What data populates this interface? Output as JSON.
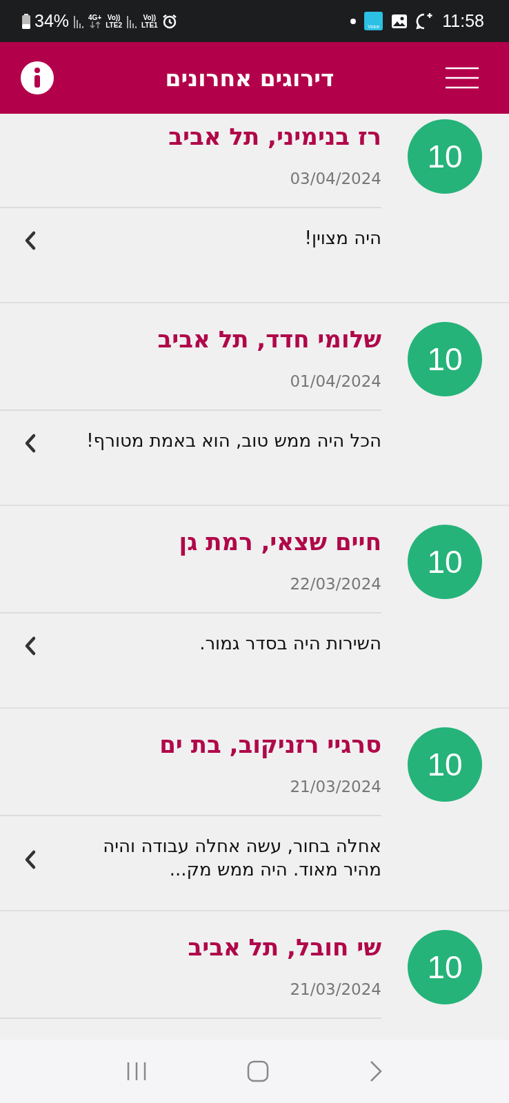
{
  "status_bar": {
    "battery": "34%",
    "network": "4G+",
    "sim2_volte": "Vo))",
    "sim2": "LTE2",
    "sim1_volte": "Vo))",
    "sim1": "LTE1",
    "app_badge": "Voice",
    "time": "11:58"
  },
  "header": {
    "title": "דירוגים אחרונים"
  },
  "reviews": [
    {
      "score": "10",
      "name": "רז בנימיני, תל אביב",
      "date": "03/04/2024",
      "comment": "היה מצוין!"
    },
    {
      "score": "10",
      "name": "שלומי חדד, תל אביב",
      "date": "01/04/2024",
      "comment": "הכל היה ממש טוב, הוא באמת מטורף!"
    },
    {
      "score": "10",
      "name": "חיים שצאי, רמת גן",
      "date": "22/03/2024",
      "comment": "השירות היה בסדר גמור."
    },
    {
      "score": "10",
      "name": "סרגיי רזניקוב, בת ים",
      "date": "21/03/2024",
      "comment": "אחלה בחור, עשה אחלה עבודה והיה מהיר מאוד. היה ממש מק..."
    },
    {
      "score": "10",
      "name": "שי חובל, תל אביב",
      "date": "21/03/2024"
    }
  ]
}
